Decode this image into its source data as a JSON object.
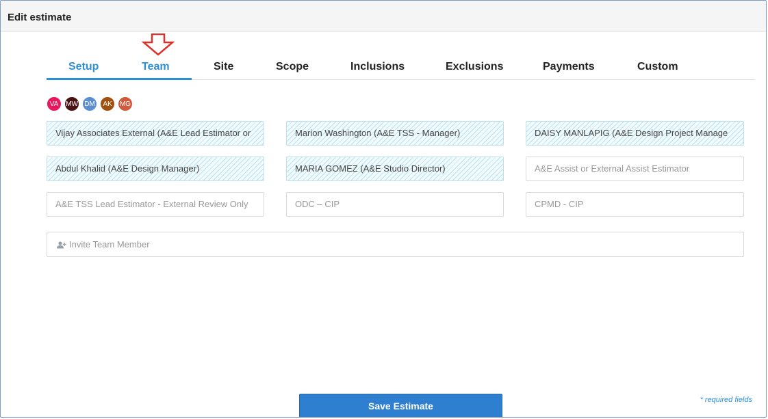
{
  "window": {
    "title": "Edit estimate"
  },
  "colors": {
    "accent": "#2c8ed6",
    "arrow": "#e0302a",
    "save_button": "#2f7fd1"
  },
  "tabs": [
    {
      "label": "Setup"
    },
    {
      "label": "Team"
    },
    {
      "label": "Site"
    },
    {
      "label": "Scope"
    },
    {
      "label": "Inclusions"
    },
    {
      "label": "Exclusions"
    },
    {
      "label": "Payments"
    },
    {
      "label": "Custom"
    }
  ],
  "active_tab": "Setup",
  "avatars": [
    {
      "initials": "VA",
      "color": "#e8185f"
    },
    {
      "initials": "MW",
      "color": "#4a1212"
    },
    {
      "initials": "DM",
      "color": "#5b8fcf"
    },
    {
      "initials": "AK",
      "color": "#a0500f"
    },
    {
      "initials": "MG",
      "color": "#d05a3c"
    }
  ],
  "team_fields": [
    {
      "value": "Vijay Associates External (A&E Lead Estimator or",
      "placeholder": ""
    },
    {
      "value": "Marion Washington (A&E TSS - Manager)",
      "placeholder": ""
    },
    {
      "value": "DAISY MANLAPIG (A&E Design Project Manage",
      "placeholder": ""
    },
    {
      "value": "Abdul Khalid (A&E Design Manager)",
      "placeholder": ""
    },
    {
      "value": "MARIA GOMEZ (A&E Studio Director)",
      "placeholder": ""
    },
    {
      "value": "",
      "placeholder": "A&E Assist or External Assist Estimator"
    },
    {
      "value": "",
      "placeholder": "A&E  TSS Lead Estimator - External Review Only"
    },
    {
      "value": "",
      "placeholder": "ODC – CIP"
    },
    {
      "value": "",
      "placeholder": "CPMD - CIP"
    }
  ],
  "invite": {
    "label": "Invite Team Member",
    "icon": "add-user-icon"
  },
  "footer": {
    "save_label": "Save Estimate",
    "required_note": "* required fields"
  }
}
